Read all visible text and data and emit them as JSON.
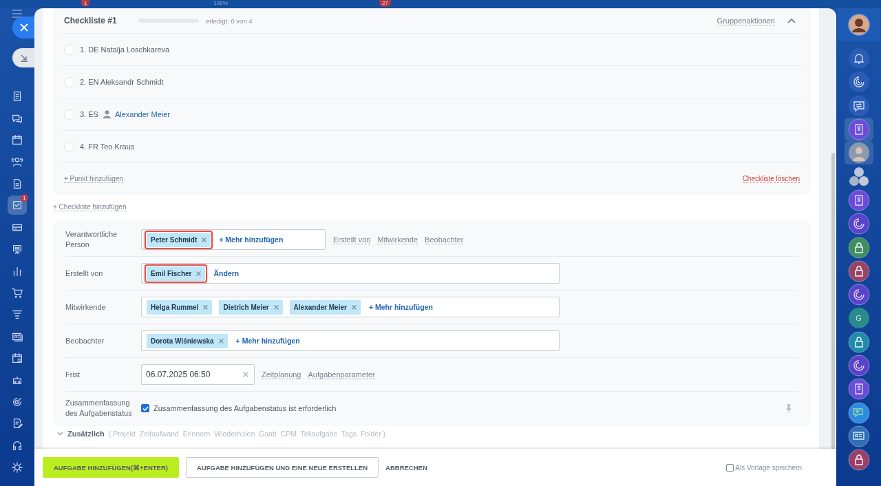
{
  "top_bar": {
    "badges": [
      {
        "text": "1",
        "kind": "badge"
      },
      {
        "text": "100%",
        "kind": "plain"
      },
      {
        "text": "27",
        "kind": "badge"
      }
    ]
  },
  "left_nav": {
    "items": [
      {
        "kind": "document",
        "selected": false
      },
      {
        "kind": "chat",
        "selected": false
      },
      {
        "kind": "calendar",
        "selected": false
      },
      {
        "kind": "people",
        "selected": false
      },
      {
        "kind": "page",
        "selected": false
      },
      {
        "kind": "tasks",
        "selected": true,
        "badge": "1"
      },
      {
        "kind": "card",
        "selected": false
      },
      {
        "kind": "board",
        "selected": false
      },
      {
        "kind": "bars",
        "selected": false
      },
      {
        "kind": "cart",
        "selected": false
      },
      {
        "kind": "funnel",
        "selected": false
      },
      {
        "kind": "contact",
        "selected": false
      },
      {
        "kind": "schedule",
        "selected": false
      },
      {
        "kind": "robot",
        "selected": false
      },
      {
        "kind": "target",
        "selected": false
      },
      {
        "kind": "edit",
        "selected": false
      },
      {
        "kind": "headset",
        "selected": false
      },
      {
        "kind": "gear",
        "selected": false
      }
    ]
  },
  "checklist": {
    "title": "Checkliste #1",
    "level": 0,
    "progress_text": "erledigt: 0 von 4",
    "group_actions": "Gruppenaktionen",
    "expanded": true,
    "items": [
      {
        "text": "1. DE Natalja Loschkareva",
        "checked": false
      },
      {
        "text": "2. EN Aleksandr Schmidt",
        "checked": false
      },
      {
        "text": "3. ES",
        "person": "Alexander Meier",
        "checked": false
      },
      {
        "text": "4. FR Teo Kraus",
        "checked": false
      }
    ],
    "add_item": "+ Punkt hinzufügen",
    "delete": "Checkliste löschen"
  },
  "add_checklist": "+ Checkliste hinzufügen",
  "form": {
    "rows": [
      {
        "kind": "people",
        "label": "Verantwortliche Person",
        "wide": false,
        "tags": [
          {
            "name": "Peter Schmidt",
            "highlighted": true
          }
        ],
        "action": "+ Mehr hinzufügen",
        "links": [
          "Erstellt von",
          "Mitwirkende",
          "Beobachter"
        ]
      },
      {
        "kind": "people",
        "label": "Erstellt von",
        "wide": true,
        "tags": [
          {
            "name": "Emil Fischer",
            "highlighted": true
          }
        ],
        "action": "Ändern"
      },
      {
        "kind": "people",
        "label": "Mitwirkende",
        "wide": true,
        "tags": [
          {
            "name": "Helga Rummel",
            "highlighted": false
          },
          {
            "name": "Dietrich Meier",
            "highlighted": false
          },
          {
            "name": "Alexander Meier",
            "highlighted": false
          }
        ],
        "action": "+ Mehr hinzufügen"
      },
      {
        "kind": "people",
        "label": "Beobachter",
        "wide": true,
        "tags": [
          {
            "name": "Dorota Wiśniewska",
            "highlighted": false
          }
        ],
        "action": "+ Mehr hinzufügen"
      },
      {
        "kind": "date",
        "label": "Frist",
        "value": "06.07.2025 06:50",
        "links": [
          "Zeitplanung",
          "Aufgabenparameter"
        ]
      },
      {
        "kind": "checkbox",
        "label": "Zusammenfassung des Aufgabenstatus",
        "checked": true,
        "text": "Zusammenfassung des Aufgabenstatus ist erforderlich"
      }
    ]
  },
  "extra": {
    "title": "Zusätzlich",
    "items": "( Projekt  Zeitaufwand  Erinnern  Wiederholen  Gantt  CPM  Teilaufgabe  Tags  Folder )"
  },
  "footer": {
    "buttons": [
      {
        "label": "AUFGABE HINZUFÜGEN(⌘+ENTER)",
        "kind": "primary"
      },
      {
        "label": "AUFGABE HINZUFÜGEN UND EINE NEUE ERSTELLEN",
        "kind": "outline"
      },
      {
        "label": "ABBRECHEN",
        "kind": "text"
      }
    ],
    "template": {
      "label": "Als Vorlage speichern",
      "checked": false
    }
  },
  "right_nav": {
    "items": [
      {
        "kind": "avatar",
        "selected": false
      },
      {
        "kind": "bell",
        "selected": false
      },
      {
        "kind": "spiral",
        "selected": false
      },
      {
        "kind": "swap",
        "selected": false
      },
      {
        "kind": "book",
        "selected": true,
        "color": "#6b4bd8"
      },
      {
        "kind": "person",
        "selected": true,
        "color": "#8a9bb0"
      },
      {
        "kind": "group",
        "selected": false
      },
      {
        "kind": "book",
        "selected": false,
        "color": "#6b4bd8"
      },
      {
        "kind": "spiral",
        "selected": false,
        "color": "#5a43c8"
      },
      {
        "kind": "lock",
        "selected": false,
        "color": "#3f8f5c"
      },
      {
        "kind": "lock",
        "selected": false,
        "color": "#9a4463"
      },
      {
        "kind": "spiral",
        "selected": false,
        "color": "#5a43c8"
      },
      {
        "kind": "letter",
        "label": "G",
        "selected": false,
        "color": "#2a8a8c"
      },
      {
        "kind": "lock",
        "selected": false,
        "color": "#1f8ca8"
      },
      {
        "kind": "spiral",
        "selected": false,
        "color": "#5a43c8"
      },
      {
        "kind": "book",
        "selected": false,
        "color": "#6b4bd8"
      },
      {
        "kind": "chat",
        "selected": false,
        "color": "#2d8be0"
      },
      {
        "kind": "contact",
        "selected": false,
        "color": "#2f6fb5"
      },
      {
        "kind": "lock",
        "selected": false,
        "color": "#9a3f66"
      }
    ]
  }
}
